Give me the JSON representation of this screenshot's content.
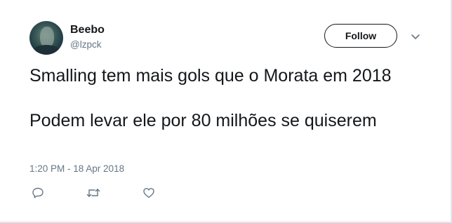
{
  "user": {
    "name": "Beebo",
    "handle": "@lzpck",
    "avatar_icon": "user-avatar"
  },
  "header": {
    "follow_label": "Follow",
    "menu_icon": "chevron-down-icon"
  },
  "tweet": {
    "paragraphs": [
      "Smalling tem mais gols que o Morata em 2018",
      "Podem levar ele por 80 milhões se quiserem"
    ],
    "timestamp": "1:20 PM - 18 Apr 2018"
  },
  "actions": [
    {
      "icon": "reply-icon"
    },
    {
      "icon": "retweet-icon"
    },
    {
      "icon": "like-icon"
    }
  ],
  "colors": {
    "text": "#14171a",
    "secondary_text": "#657786",
    "border": "#e1e8ed"
  }
}
